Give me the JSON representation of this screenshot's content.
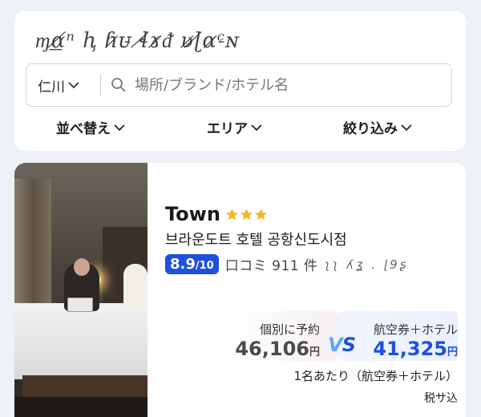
{
  "header": {
    "garbled_title": "ɱ͟ɑ̸ⁿ ⱨ ɦ̷ᴜ̵ ɬ̸ɤ̷ᵭ ʋ̷ɭ̸ɑ̷ᶜ̵ɴ"
  },
  "search": {
    "location_label": "仁川",
    "placeholder": "場所/ブランド/ホテル名"
  },
  "filters": {
    "sort": "並べ替え",
    "area": "エリア",
    "narrow": "絞り込み"
  },
  "hotel": {
    "brand": "Town",
    "stars": 3,
    "name": "브라운도트 호텔 공항신도시점",
    "score": "8.9",
    "score_denominator": "/10",
    "reviews": "口コミ 911 件",
    "reviews_garbled": "ʅʅ  ʎʓ .  ɭ9ʂ",
    "individual_label": "個別に予約",
    "individual_price": "46,106",
    "package_label": "航空券＋ホテル",
    "package_price": "41,325",
    "yen": "円",
    "vs_v": "V",
    "vs_s": "S",
    "per_person": "1名あたり（航空券＋ホテル）",
    "tax": "税サ込"
  },
  "colors": {
    "accent_blue": "#1f4fe0",
    "star_gold": "#f5b722",
    "background": "#eef1f5"
  },
  "icons": {
    "search": "search-icon",
    "chevron": "chevron-down-icon",
    "star": "star-icon"
  }
}
